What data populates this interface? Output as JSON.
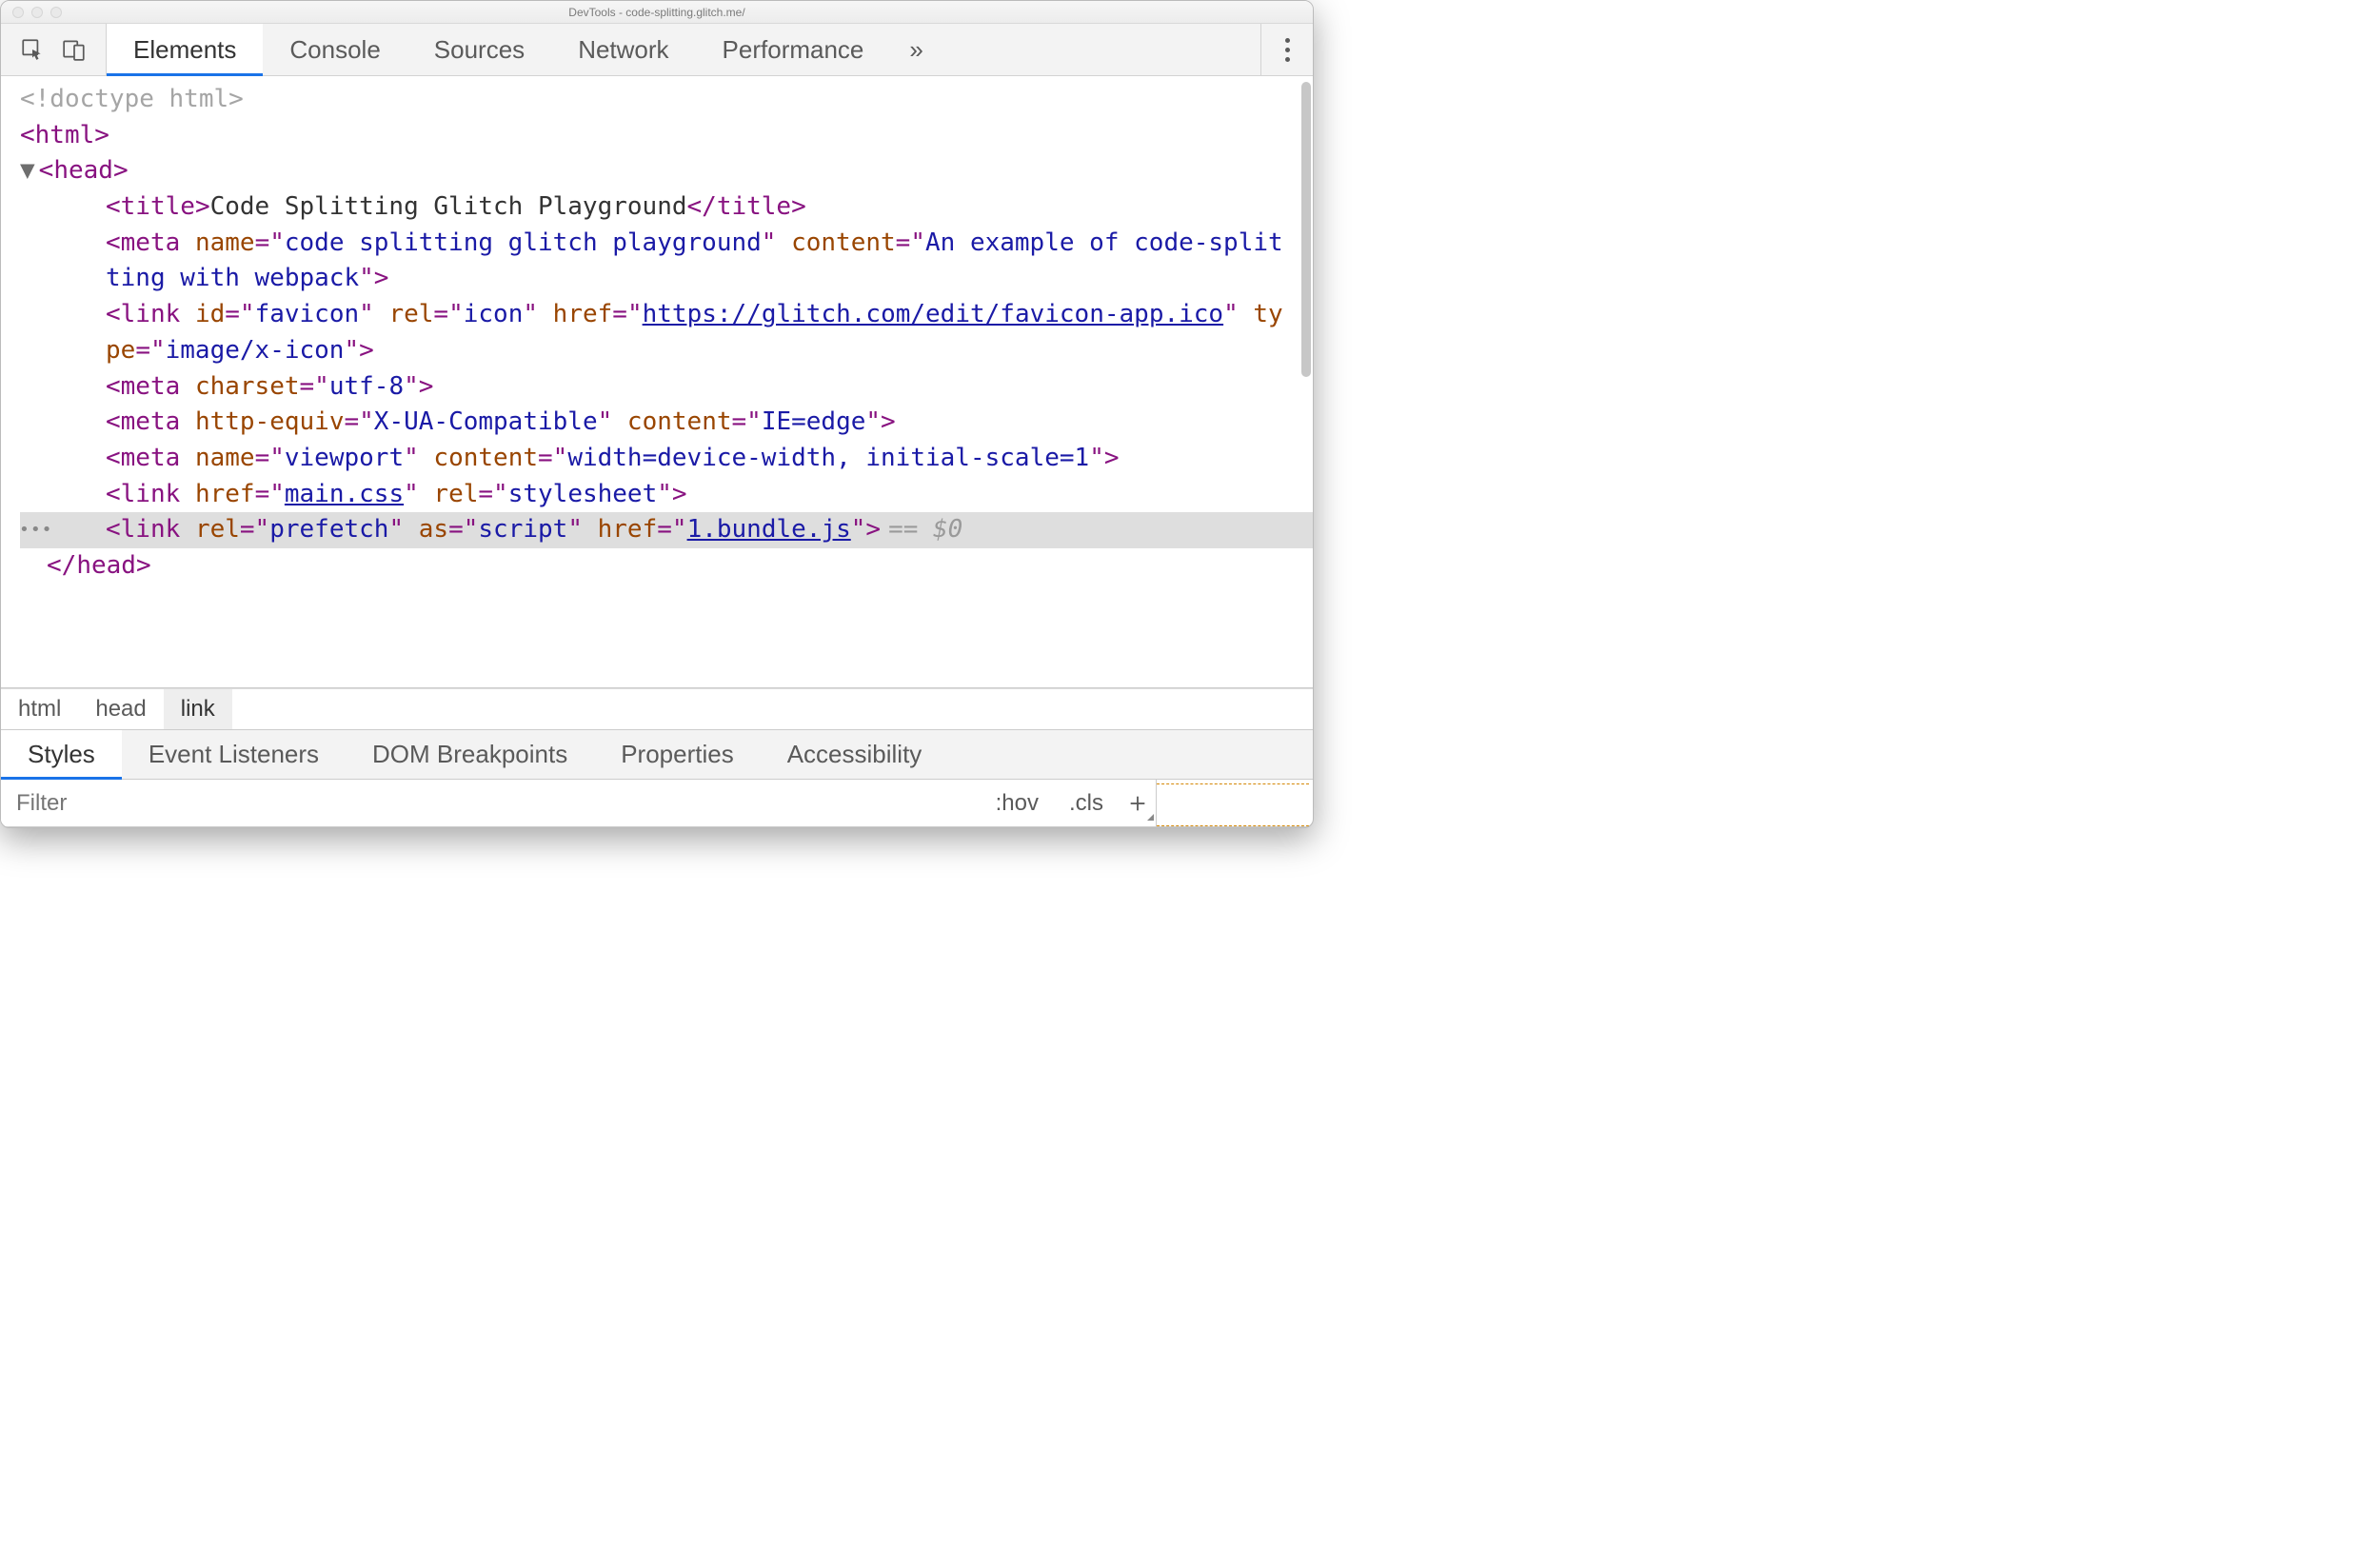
{
  "window": {
    "title": "DevTools - code-splitting.glitch.me/"
  },
  "mainTabs": {
    "items": [
      "Elements",
      "Console",
      "Sources",
      "Network",
      "Performance"
    ],
    "activeIndex": 0,
    "overflow": "»"
  },
  "dom": {
    "doctype": "<!doctype html>",
    "htmlOpen": "html",
    "headOpen": "head",
    "title": {
      "tag": "title",
      "text": "Code Splitting Glitch Playground"
    },
    "meta1": {
      "tag": "meta",
      "name": "code splitting glitch playground",
      "content": "An example of code-splitting with webpack"
    },
    "link1": {
      "tag": "link",
      "id": "favicon",
      "rel": "icon",
      "href": "https://glitch.com/edit/favicon-app.ico",
      "type": "image/x-icon"
    },
    "meta2": {
      "tag": "meta",
      "charset": "utf-8"
    },
    "meta3": {
      "tag": "meta",
      "httpEquiv": "X-UA-Compatible",
      "content": "IE=edge"
    },
    "meta4": {
      "tag": "meta",
      "name": "viewport",
      "content": "width=device-width, initial-scale=1"
    },
    "link2": {
      "tag": "link",
      "href": "main.css",
      "rel": "stylesheet"
    },
    "selected": {
      "tag": "link",
      "rel": "prefetch",
      "as": "script",
      "href": "1.bundle.js",
      "suffix": "== $0"
    },
    "headClose": "head"
  },
  "breadcrumb": [
    "html",
    "head",
    "link"
  ],
  "subTabs": {
    "items": [
      "Styles",
      "Event Listeners",
      "DOM Breakpoints",
      "Properties",
      "Accessibility"
    ],
    "activeIndex": 0
  },
  "filter": {
    "placeholder": "Filter",
    "hov": ":hov",
    "cls": ".cls"
  }
}
